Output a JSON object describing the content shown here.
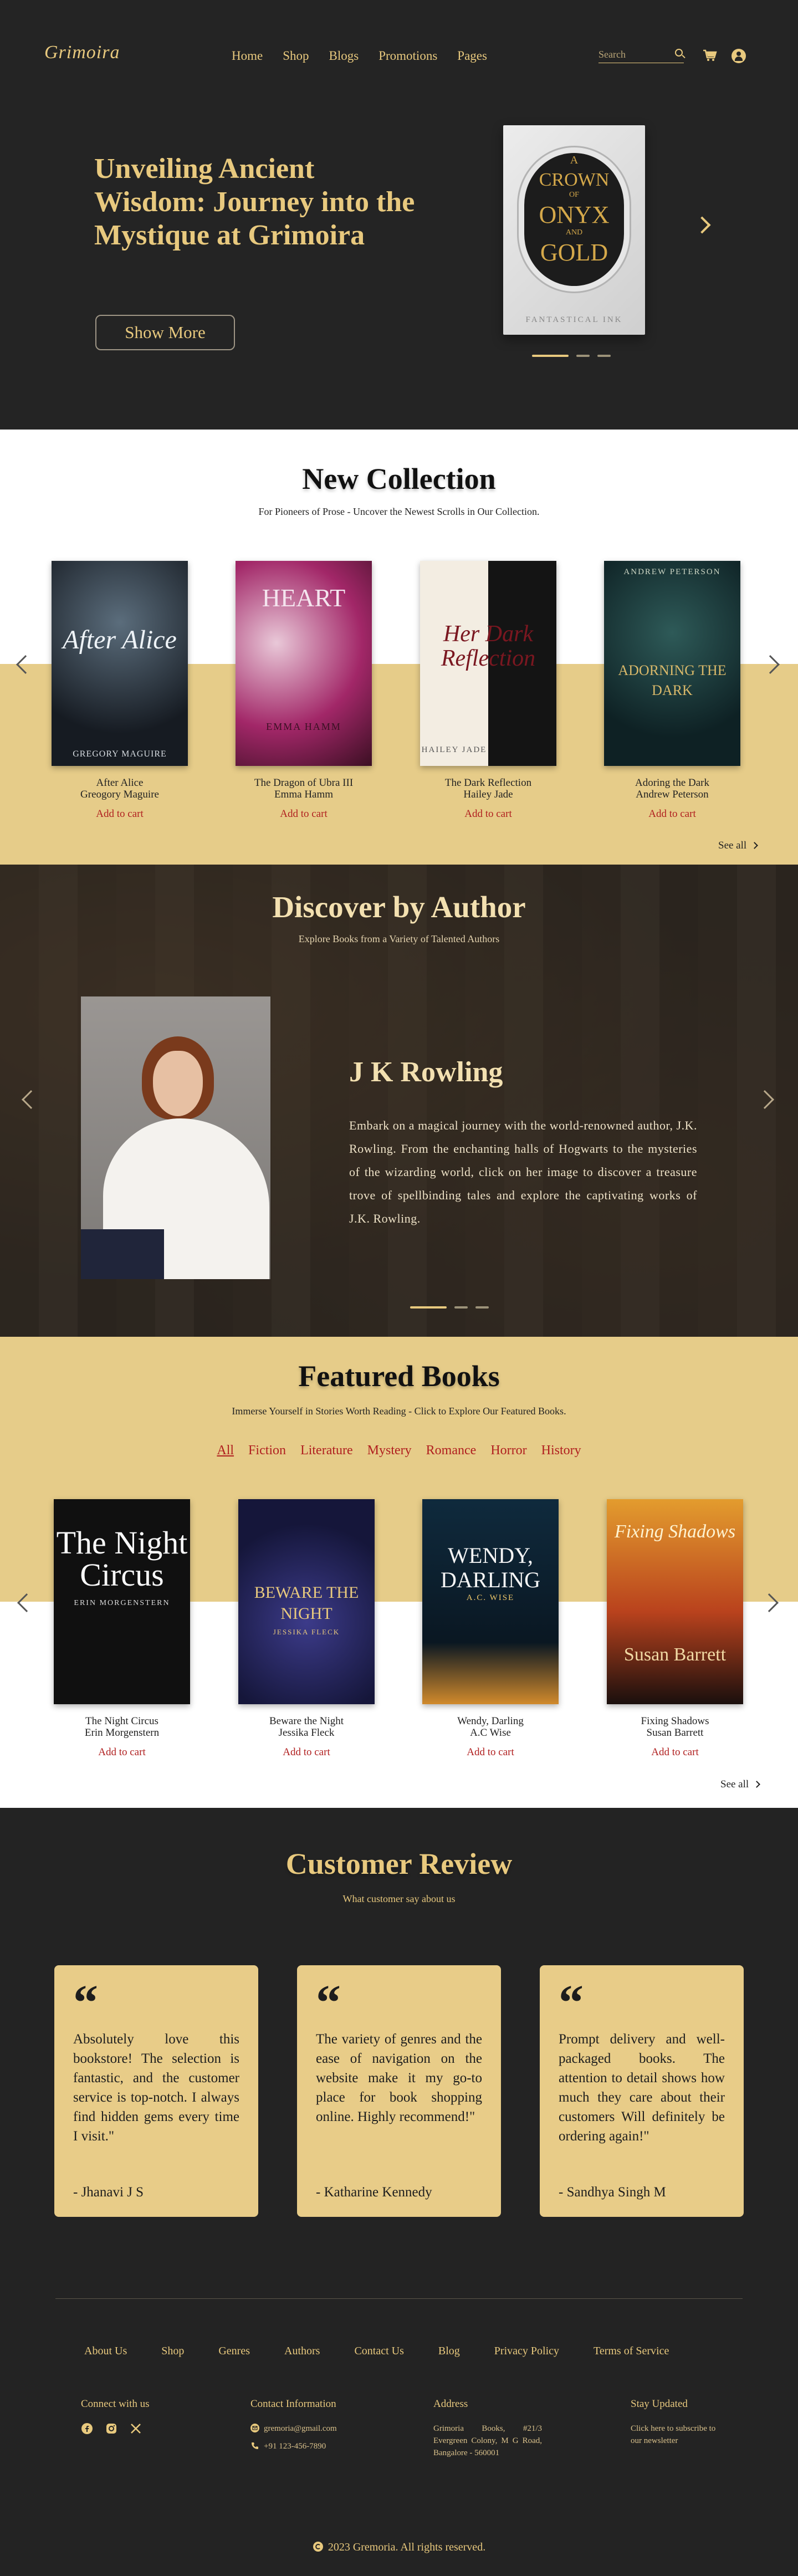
{
  "header": {
    "logo": "Grimoira",
    "nav": [
      "Home",
      "Shop",
      "Blogs",
      "Promotions",
      "Pages"
    ],
    "search_placeholder": "Search"
  },
  "hero": {
    "title": "Unveiling Ancient Wisdom: Journey into the Mystique at Grimoira",
    "button": "Show More",
    "book": {
      "line1": "A",
      "line2": "CROWN",
      "line3": "OF",
      "line4": "ONYX",
      "line5": "AND",
      "line6": "GOLD",
      "publisher": "FANTASTICAL INK"
    },
    "slide_index": 1,
    "slide_count": 3
  },
  "new_collection": {
    "title": "New Collection",
    "subtitle": "For Pioneers of Prose - Uncover the Newest Scrolls in Our Collection.",
    "books": [
      {
        "title": "After Alice",
        "author": "Greogory Maguire",
        "cover_text": "After Alice",
        "cover_author": "GREGORY MAGUIRE",
        "add": "Add to cart"
      },
      {
        "title": "The Dragon of Ubra III",
        "author": "Emma Hamm",
        "cover_text": "HEART",
        "cover_author": "EMMA HAMM",
        "add": "Add to cart"
      },
      {
        "title": "The Dark Reflection",
        "author": "Hailey Jade",
        "cover_text": "Her Dark Reflection",
        "cover_author": "HAILEY JADE",
        "add": "Add to cart"
      },
      {
        "title": "Adoring the Dark",
        "author": "Andrew Peterson",
        "cover_text": "ADORNING THE DARK",
        "cover_author": "ANDREW PETERSON",
        "add": "Add to cart"
      }
    ],
    "see_all": "See all"
  },
  "author": {
    "title": "Discover by Author",
    "subtitle": "Explore Books from a Variety of Talented Authors",
    "name": "J K Rowling",
    "bio": "Embark on a magical journey with the world-renowned author, J.K. Rowling. From the enchanting halls of Hogwarts to the mysteries of the wizarding world, click on her image to discover a treasure trove of spellbinding tales and explore the captivating works of J.K. Rowling.",
    "slide_index": 1,
    "slide_count": 3
  },
  "featured": {
    "title": "Featured Books",
    "subtitle": "Immerse Yourself in Stories Worth Reading - Click to Explore Our Featured Books.",
    "categories": [
      "All",
      "Fiction",
      "Literature",
      "Mystery",
      "Romance",
      "Horror",
      "History"
    ],
    "active_category": "All",
    "books": [
      {
        "title": "The Night Circus",
        "author": "Erin Morgenstern",
        "cover_text": "The Night Circus",
        "cover_author": "ERIN MORGENSTERN",
        "add": "Add to cart"
      },
      {
        "title": "Beware the Night",
        "author": "Jessika Fleck",
        "cover_text": "BEWARE THE NIGHT",
        "cover_author": "JESSIKA FLECK",
        "add": "Add to cart"
      },
      {
        "title": "Wendy, Darling",
        "author": "A.C Wise",
        "cover_text": "WENDY, DARLING",
        "cover_author": "A.C. WISE",
        "add": "Add to cart"
      },
      {
        "title": "Fixing Shadows",
        "author": "Susan Barrett",
        "cover_text": "Fixing Shadows",
        "cover_author": "Susan Barrett",
        "add": "Add to cart"
      }
    ],
    "see_all": "See all"
  },
  "reviews": {
    "title": "Customer Review",
    "subtitle": "What customer say about us",
    "items": [
      {
        "text": "Absolutely love this bookstore! The selection is fantastic, and the customer service is top-notch. I always find hidden gems every time I visit.\"",
        "name": "- Jhanavi J S"
      },
      {
        "text": "The variety of genres and the ease of navigation on the website make it my go-to place for book shopping online. Highly recommend!\"",
        "name": "- Katharine Kennedy"
      },
      {
        "text": "Prompt delivery and well-packaged books. The attention to detail shows how much they care about their customers Will definitely be ordering again!\"",
        "name": "- Sandhya Singh M"
      }
    ]
  },
  "footer": {
    "links": [
      "About Us",
      "Shop",
      "Genres",
      "Authors",
      "Contact Us",
      "Blog",
      "Privacy Policy",
      "Terms of Service"
    ],
    "connect": "Connect with us",
    "contact_title": "Contact Information",
    "email": "gremoria@gmail.com",
    "phone": "+91 123-456-7890",
    "address_title": "Address",
    "address": "Grimoria Books, #21/3 Evergreen Colony, M G Road, Bangalore - 560001",
    "stay_title": "Stay Updated",
    "stay_text": "Click here to subscribe to our newsletter",
    "copyright": "2023 Gremoria. All rights reserved."
  },
  "colors": {
    "accent": "#e8c97e",
    "band": "#e6cc89",
    "dark": "#232323",
    "link_red": "#b01f1f"
  }
}
